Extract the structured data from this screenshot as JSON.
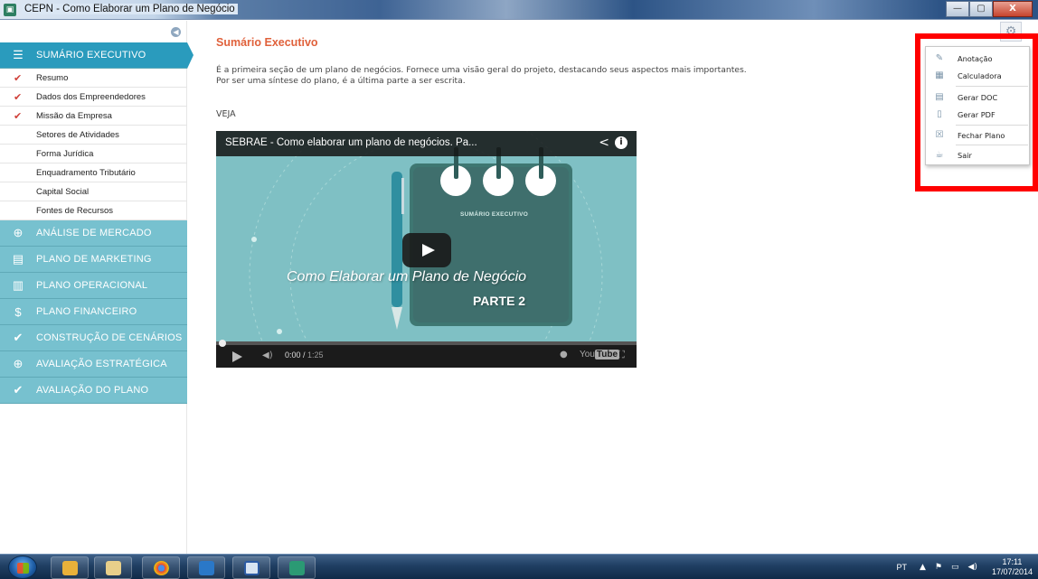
{
  "window": {
    "title": "CEPN - Como Elaborar um Plano de Negócio",
    "buttons": {
      "minimize": "—",
      "maximize": "▢",
      "close": "X"
    }
  },
  "sidebar": {
    "collapse_icon": "collapse-icon",
    "sections": [
      {
        "label": "SUMÁRIO EXECUTIVO",
        "icon": "list-icon",
        "active": true
      },
      {
        "label": "ANÁLISE DE MERCADO",
        "icon": "globe-icon"
      },
      {
        "label": "PLANO DE MARKETING",
        "icon": "chat-icon"
      },
      {
        "label": "PLANO OPERACIONAL",
        "icon": "clipboard-icon"
      },
      {
        "label": "PLANO FINANCEIRO",
        "icon": "dollar-icon"
      },
      {
        "label": "CONSTRUÇÃO DE CENÁRIOS",
        "icon": "check-icon"
      },
      {
        "label": "AVALIAÇÃO ESTRATÉGICA",
        "icon": "crosshair-icon"
      },
      {
        "label": "AVALIAÇÃO DO PLANO",
        "icon": "check-icon"
      }
    ],
    "subitems": [
      {
        "label": "Resumo",
        "checked": true
      },
      {
        "label": "Dados dos Empreendedores",
        "checked": true
      },
      {
        "label": "Missão da Empresa",
        "checked": true
      },
      {
        "label": "Setores de Atividades",
        "checked": false
      },
      {
        "label": "Forma Jurídica",
        "checked": false
      },
      {
        "label": "Enquadramento Tributário",
        "checked": false
      },
      {
        "label": "Capital Social",
        "checked": false
      },
      {
        "label": "Fontes de Recursos",
        "checked": false
      }
    ]
  },
  "main": {
    "title": "Sumário Executivo",
    "description_line1": "É a primeira seção de um plano de negócios. Fornece uma visão geral do projeto, destacando seus aspectos mais importantes.",
    "description_line2": "Por ser uma síntese do plano, é a última parte a ser escrita.",
    "veja": "VEJA"
  },
  "video": {
    "title": "SEBRAE - Como elaborar um plano de negócios. Pa...",
    "overlay_label": "SUMÁRIO EXECUTIVO",
    "overlay_title": "Como Elaborar um Plano de Negócio",
    "overlay_part": "PARTE 2",
    "time_current": "0:00",
    "time_total": "1:25",
    "progress": 0.0,
    "youtube_label": "You",
    "youtube_label2": "Tube",
    "accent": "#7fc0c4"
  },
  "menu": {
    "items": [
      {
        "label": "Anotação",
        "icon": "pencil-icon"
      },
      {
        "label": "Calculadora",
        "icon": "calculator-icon"
      },
      {
        "label": "Gerar DOC",
        "icon": "doc-icon"
      },
      {
        "label": "Gerar PDF",
        "icon": "pdf-icon"
      },
      {
        "label": "Fechar Plano",
        "icon": "close-plan-icon"
      },
      {
        "label": "Sair",
        "icon": "exit-icon"
      }
    ]
  },
  "taskbar": {
    "lang": "PT",
    "time": "17:11",
    "date": "17/07/2014"
  },
  "colors": {
    "active_section": "#2a9bbd",
    "section": "#77c1cf",
    "title_orange": "#e0613b",
    "highlight": "#ff0000"
  }
}
